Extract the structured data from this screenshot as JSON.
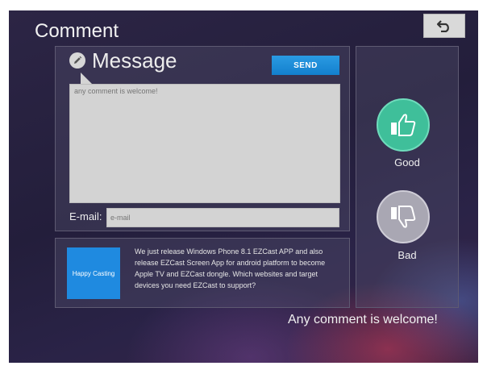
{
  "header": {
    "title": "Comment",
    "back_icon": "back-arrow-icon"
  },
  "message": {
    "title": "Message",
    "icon": "pencil-icon",
    "send_label": "SEND",
    "comment_placeholder": "any comment is welcome!",
    "email_label": "E-mail:",
    "email_placeholder": "e-mail"
  },
  "news": {
    "tile_label": "Happy Casting",
    "text": "We just release Windows Phone 8.1 EZCast APP and also release EZCast Screen App for android platform to become Apple TV and EZCast dongle. Which websites and target devices you need EZCast to support?"
  },
  "rating": {
    "good_label": "Good",
    "bad_label": "Bad",
    "good_icon": "thumbs-up-icon",
    "bad_icon": "thumbs-down-icon"
  },
  "footer": {
    "text": "Any comment is welcome!"
  },
  "colors": {
    "send_button": "#1f8ae0",
    "good": "#3fbf9a",
    "bad": "#a9a7b3",
    "tile": "#1f8ae0"
  }
}
